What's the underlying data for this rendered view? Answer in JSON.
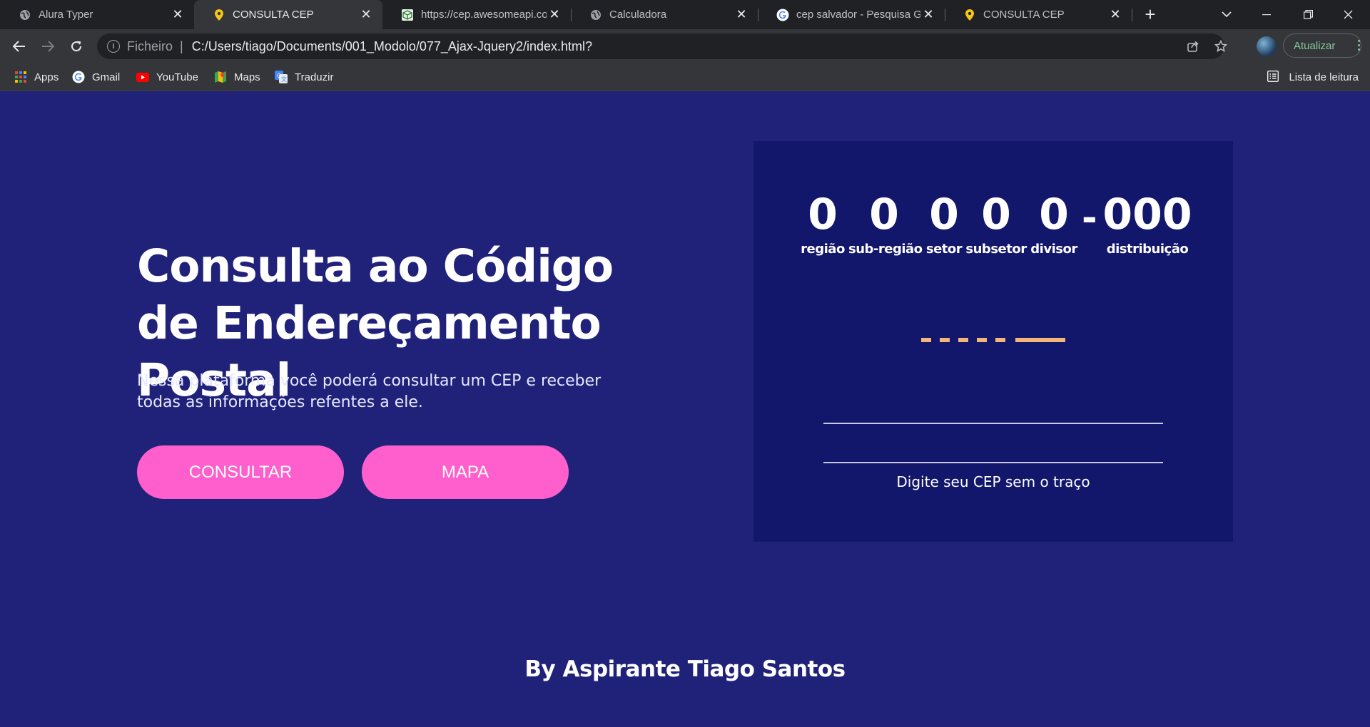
{
  "browser": {
    "tabs": [
      {
        "title": "Alura Typer",
        "favicon": "globe-icon",
        "active": false
      },
      {
        "title": "CONSULTA CEP",
        "favicon": "map-pin-icon",
        "active": true
      },
      {
        "title": "https://cep.awesomeapi.com",
        "favicon": "api-cube-icon",
        "active": false
      },
      {
        "title": "Calculadora",
        "favicon": "globe-icon",
        "active": false
      },
      {
        "title": "cep salvador - Pesquisa Goo",
        "favicon": "google-icon",
        "active": false
      },
      {
        "title": "CONSULTA CEP",
        "favicon": "map-pin-icon",
        "active": false
      }
    ],
    "new_tab_symbol": "+",
    "close_symbol": "✕",
    "address": {
      "scheme_label": "Ficheiro",
      "separator": "|",
      "url": "C:/Users/tiago/Documents/001_Modolo/077_Ajax-Jquery2/index.html?"
    },
    "update_label": "Atualizar",
    "bookmarks": [
      {
        "label": "Apps",
        "icon": "apps-grid-icon"
      },
      {
        "label": "Gmail",
        "icon": "google-icon"
      },
      {
        "label": "YouTube",
        "icon": "youtube-icon"
      },
      {
        "label": "Maps",
        "icon": "maps-icon"
      },
      {
        "label": "Traduzir",
        "icon": "translate-icon"
      }
    ],
    "reading_list_label": "Lista de leitura"
  },
  "page": {
    "title": "Consulta ao Código de Endereçamento Postal",
    "description": "Nessa plataforma você poderá consultar um CEP e receber todas as informações refentes a ele.",
    "buttons": {
      "consult": "CONSULTAR",
      "map": "MAPA"
    },
    "cep_digits": [
      {
        "value": "0",
        "label": "região"
      },
      {
        "value": "0",
        "label": "sub-região"
      },
      {
        "value": "0",
        "label": "setor"
      },
      {
        "value": "0",
        "label": "subsetor"
      },
      {
        "value": "0",
        "label": "divisor"
      },
      {
        "value": "000",
        "label": "distribuição"
      }
    ],
    "digit_separator": "-",
    "input_hint": "Digite seu CEP sem o traço",
    "input_value": "",
    "credit": "By Aspirante Tiago Santos",
    "colors": {
      "page_bg": "#20227a",
      "card_bg": "#12176c",
      "button_bg": "#ff5fcc",
      "dash_color": "#f3b679"
    }
  }
}
